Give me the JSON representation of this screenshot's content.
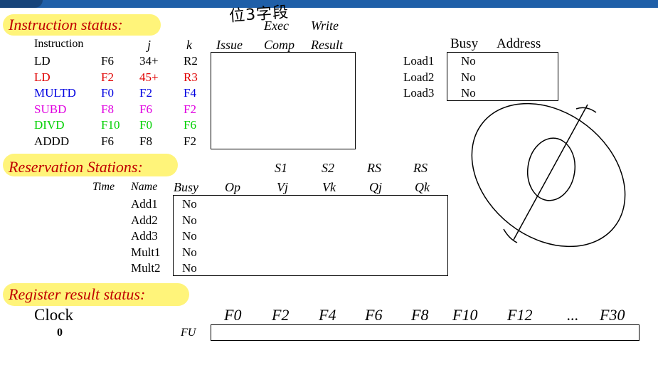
{
  "handwriting": "位3字段",
  "instruction_status": {
    "title": "Instruction status:",
    "headers": {
      "instruction": "Instruction",
      "j": "j",
      "k": "k",
      "issue": "Issue",
      "exec_top": "Exec",
      "exec_bottom": "Comp",
      "write_top": "Write",
      "write_bottom": "Result"
    },
    "rows": [
      {
        "op": "LD",
        "dest": "F6",
        "j": "34+",
        "k": "R2",
        "color": "#000000"
      },
      {
        "op": "LD",
        "dest": "F2",
        "j": "45+",
        "k": "R3",
        "color": "#e00000"
      },
      {
        "op": "MULTD",
        "dest": "F0",
        "j": "F2",
        "k": "F4",
        "color": "#0000e0"
      },
      {
        "op": "SUBD",
        "dest": "F8",
        "j": "F6",
        "k": "F2",
        "color": "#e000e0"
      },
      {
        "op": "DIVD",
        "dest": "F10",
        "j": "F0",
        "k": "F6",
        "color": "#00d000"
      },
      {
        "op": "ADDD",
        "dest": "F6",
        "j": "F8",
        "k": "F2",
        "color": "#000000"
      }
    ]
  },
  "load_buffers": {
    "headers": {
      "busy": "Busy",
      "address": "Address"
    },
    "rows": [
      {
        "name": "Load1",
        "busy": "No"
      },
      {
        "name": "Load2",
        "busy": "No"
      },
      {
        "name": "Load3",
        "busy": "No"
      }
    ]
  },
  "reservation_stations": {
    "title": "Reservation Stations:",
    "headers": {
      "time": "Time",
      "name": "Name",
      "busy": "Busy",
      "op": "Op",
      "s1": "S1",
      "vj": "Vj",
      "s2": "S2",
      "vk": "Vk",
      "rs1": "RS",
      "qj": "Qj",
      "rs2": "RS",
      "qk": "Qk"
    },
    "rows": [
      {
        "name": "Add1",
        "busy": "No"
      },
      {
        "name": "Add2",
        "busy": "No"
      },
      {
        "name": "Add3",
        "busy": "No"
      },
      {
        "name": "Mult1",
        "busy": "No"
      },
      {
        "name": "Mult2",
        "busy": "No"
      }
    ]
  },
  "register_status": {
    "title": "Register result status:",
    "clock_label": "Clock",
    "clock_value": "0",
    "fu_label": "FU",
    "registers": [
      "F0",
      "F2",
      "F4",
      "F6",
      "F8",
      "F10",
      "F12",
      "...",
      "F30"
    ]
  },
  "colors": {
    "title": "#c00000",
    "highlight": "#fff36b",
    "topbar": "#1f5fa8"
  }
}
